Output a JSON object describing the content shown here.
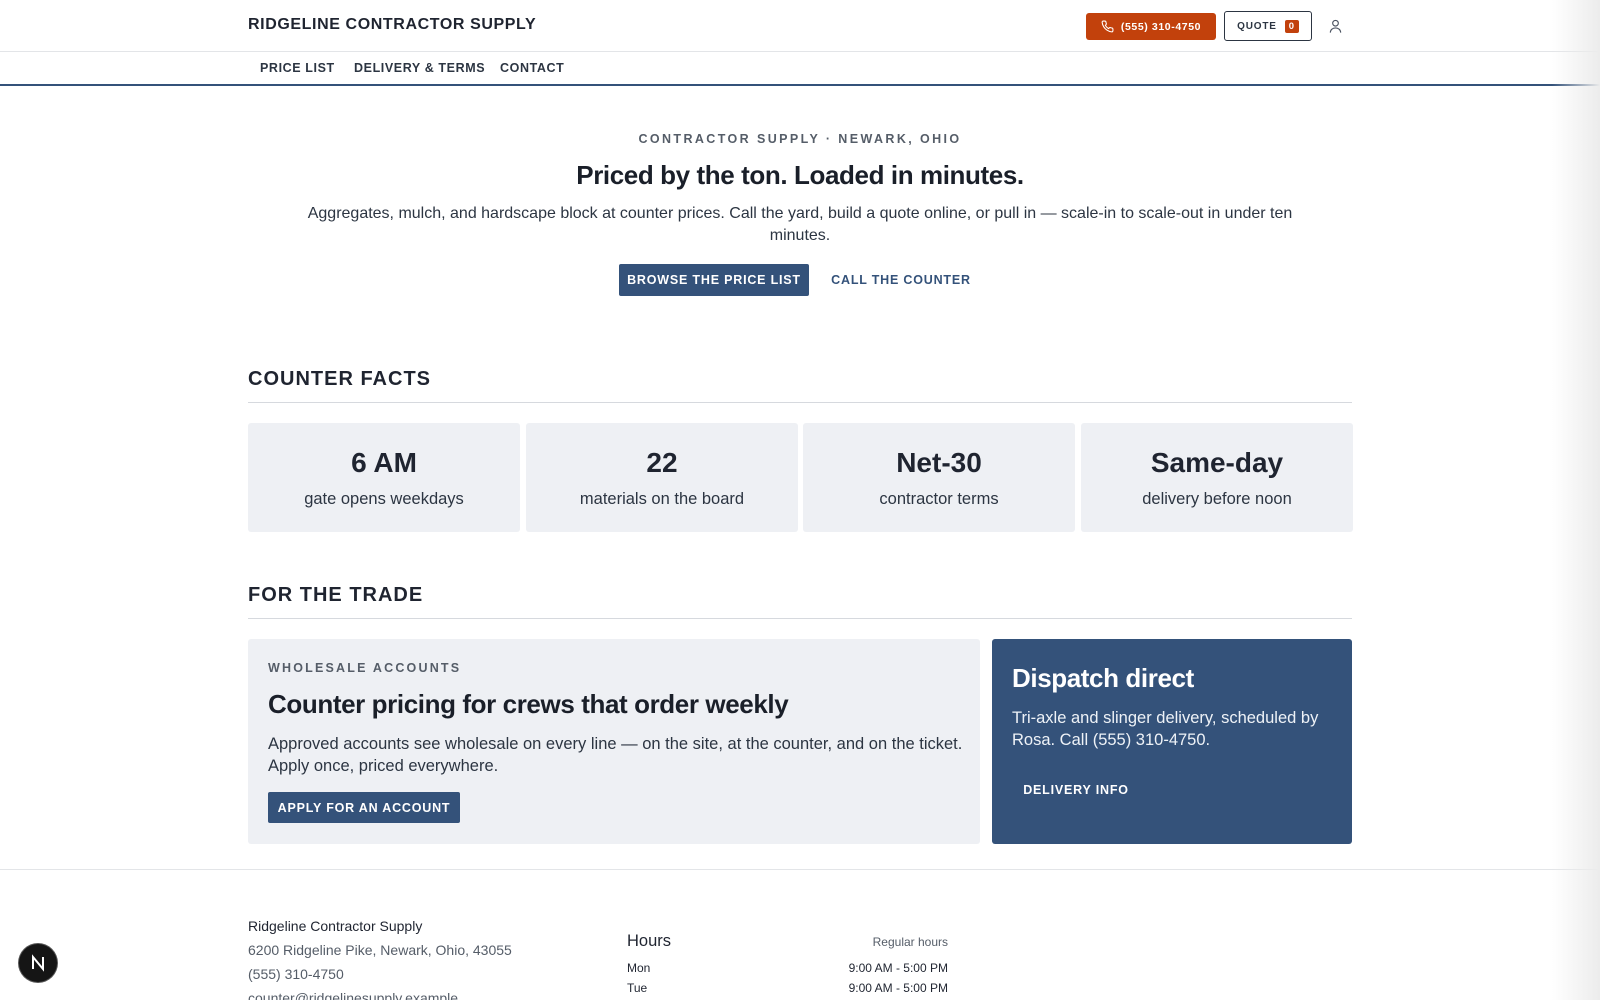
{
  "header": {
    "brand": "RIDGELINE CONTRACTOR SUPPLY",
    "phone_label": "(555) 310-4750",
    "quote_label": "QUOTE",
    "quote_count": "0",
    "icons": {
      "phone": "phone-icon",
      "user": "user-icon"
    },
    "accent_color": "#c2410c"
  },
  "nav": {
    "items": [
      "PRICE LIST",
      "DELIVERY & TERMS",
      "CONTACT"
    ]
  },
  "hero": {
    "eyebrow": "CONTRACTOR SUPPLY · NEWARK, OHIO",
    "title": "Priced by the ton. Loaded in minutes.",
    "subtitle": "Aggregates, mulch, and hardscape block at counter prices. Call the yard, build a quote online, or pull in — scale-in to scale-out in under ten minutes.",
    "primary_cta": "BROWSE THE PRICE LIST",
    "secondary_cta": "CALL THE COUNTER"
  },
  "facts": {
    "title": "COUNTER FACTS",
    "items": [
      {
        "value": "6 AM",
        "label": "gate opens weekdays"
      },
      {
        "value": "22",
        "label": "materials on the board"
      },
      {
        "value": "Net-30",
        "label": "contractor terms"
      },
      {
        "value": "Same-day",
        "label": "delivery before noon"
      }
    ]
  },
  "trade": {
    "title": "FOR THE TRADE",
    "wholesale": {
      "eyebrow": "WHOLESALE ACCOUNTS",
      "title": "Counter pricing for crews that order weekly",
      "body": "Approved accounts see wholesale on every line — on the site, at the counter, and on the ticket. Apply once, priced everywhere.",
      "cta": "APPLY FOR AN ACCOUNT"
    },
    "dispatch": {
      "title": "Dispatch direct",
      "body": "Tri-axle and slinger delivery, scheduled by Rosa. Call (555) 310-4750.",
      "cta": "DELIVERY INFO",
      "color": "#34527a"
    }
  },
  "footer": {
    "name": "Ridgeline Contractor Supply",
    "address": "6200 Ridgeline Pike, Newark, Ohio, 43055",
    "phone": "(555) 310-4750",
    "email": "counter@ridgelinesupply.example",
    "hours_title": "Hours",
    "hours_note": "Regular hours",
    "hours": [
      {
        "day": "Mon",
        "time": "9:00 AM - 5:00 PM"
      },
      {
        "day": "Tue",
        "time": "9:00 AM - 5:00 PM"
      }
    ]
  },
  "badge": {
    "letter": "N",
    "icon": "n-logo-icon"
  }
}
